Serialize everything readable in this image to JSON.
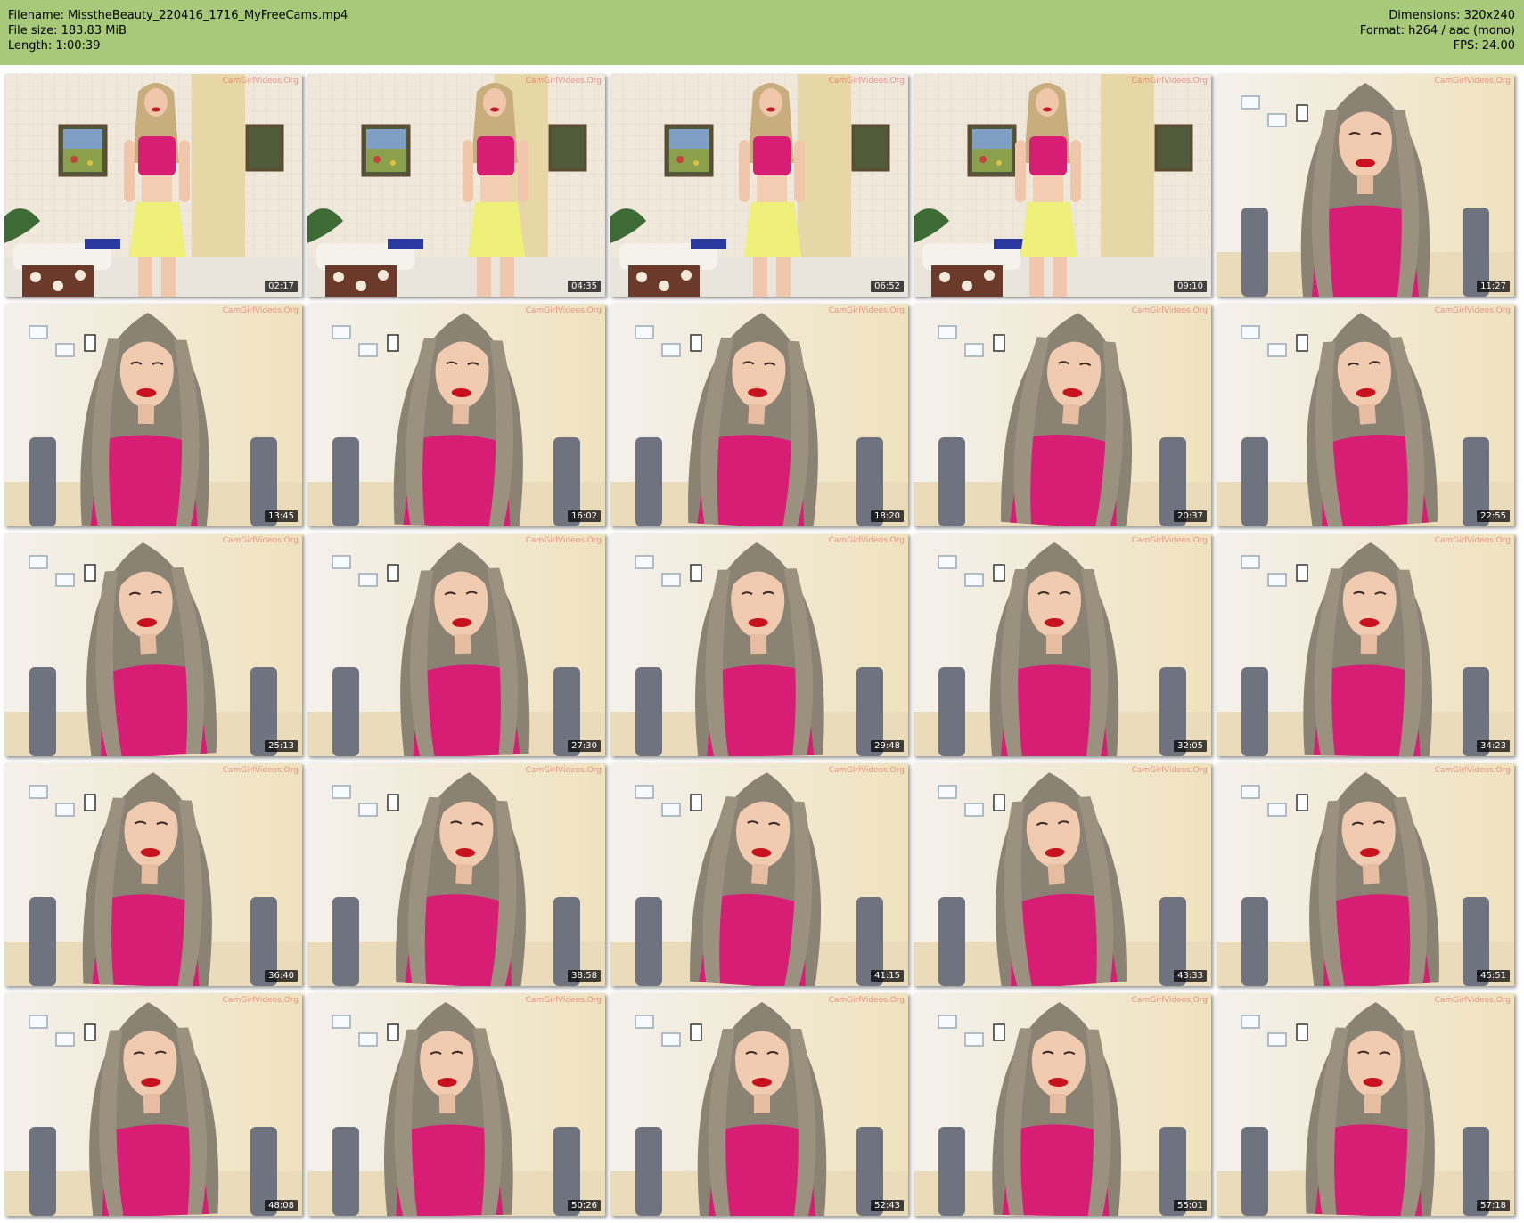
{
  "header": {
    "filename": "Filename: MisstheBeauty_220416_1716_MyFreeCams.mp4",
    "file_size": "File size: 183.83 MiB",
    "length": "Length: 1:00:39",
    "dimensions": "Dimensions: 320x240",
    "format": "Format: h264 / aac (mono)",
    "fps": "FPS: 24.00"
  },
  "colors": {
    "header_bg": "#a9c97a",
    "top": "#d81d74",
    "skirt": "#eef07a",
    "hair": "#8a8272",
    "wall": "#efe8db"
  },
  "watermark": "CamGirlVideos.Org",
  "thumbnails": [
    {
      "time": "02:17",
      "scene": "standing"
    },
    {
      "time": "04:35",
      "scene": "standing"
    },
    {
      "time": "06:52",
      "scene": "standing"
    },
    {
      "time": "09:10",
      "scene": "standing"
    },
    {
      "time": "11:27",
      "scene": "closeup"
    },
    {
      "time": "13:45",
      "scene": "closeup"
    },
    {
      "time": "16:02",
      "scene": "closeup"
    },
    {
      "time": "18:20",
      "scene": "closeup"
    },
    {
      "time": "20:37",
      "scene": "closeup"
    },
    {
      "time": "22:55",
      "scene": "closeup"
    },
    {
      "time": "25:13",
      "scene": "closeup"
    },
    {
      "time": "27:30",
      "scene": "closeup"
    },
    {
      "time": "29:48",
      "scene": "closeup"
    },
    {
      "time": "32:05",
      "scene": "closeup"
    },
    {
      "time": "34:23",
      "scene": "closeup"
    },
    {
      "time": "36:40",
      "scene": "closeup"
    },
    {
      "time": "38:58",
      "scene": "closeup"
    },
    {
      "time": "41:15",
      "scene": "closeup"
    },
    {
      "time": "43:33",
      "scene": "closeup"
    },
    {
      "time": "45:51",
      "scene": "closeup"
    },
    {
      "time": "48:08",
      "scene": "closeup"
    },
    {
      "time": "50:26",
      "scene": "closeup"
    },
    {
      "time": "52:43",
      "scene": "closeup"
    },
    {
      "time": "55:01",
      "scene": "closeup"
    },
    {
      "time": "57:18",
      "scene": "closeup"
    }
  ]
}
